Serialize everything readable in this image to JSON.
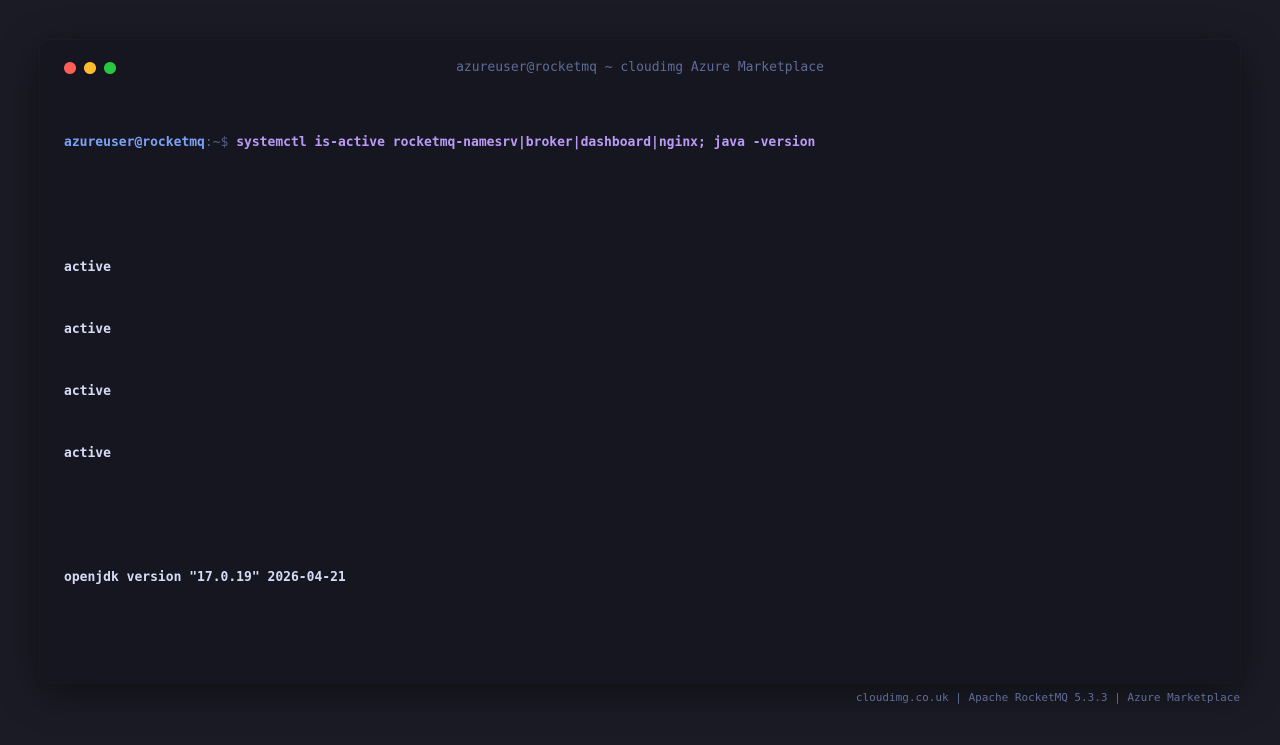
{
  "window": {
    "title": "azureuser@rocketmq ~ cloudimg Azure Marketplace",
    "traffic_lights": [
      {
        "name": "close",
        "color": "#ff5f57"
      },
      {
        "name": "minimize",
        "color": "#febc2e"
      },
      {
        "name": "maximize",
        "color": "#28c840"
      }
    ]
  },
  "terminal": {
    "prompt_user": "azureuser@rocketmq",
    "prompt_path": ":~$ ",
    "command": "systemctl is-active rocketmq-namesrv|broker|dashboard|nginx; java -version",
    "output_status": [
      "active",
      "active",
      "active",
      "active"
    ],
    "java_version_line": "openjdk version \"17.0.19\" 2026-04-21"
  },
  "footer": {
    "text": "cloudimg.co.uk | Apache RocketMQ 5.3.3 | Azure Marketplace"
  },
  "colors": {
    "background": "#1b1b26",
    "terminal_bg": "#161620",
    "prompt_user": "#7aa2f7",
    "command": "#bb9af7",
    "output": "#d6dbf5",
    "muted": "#5f6b96"
  }
}
